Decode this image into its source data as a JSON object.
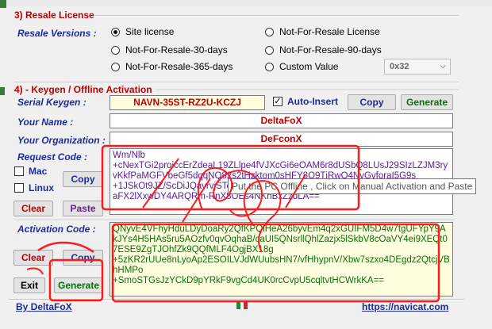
{
  "resale": {
    "title": "3) Resale License",
    "versions_label": "Resale Versions :",
    "options": [
      {
        "label": "Site license",
        "selected": true
      },
      {
        "label": "Not-For-Resale License",
        "selected": false
      },
      {
        "label": "Not-For-Resale-30-days",
        "selected": false
      },
      {
        "label": "Not-For-Resale-90-days",
        "selected": false
      },
      {
        "label": "Not-For-Resale-365-days",
        "selected": false
      },
      {
        "label": "Custom Value",
        "selected": false
      }
    ],
    "custom_value": "0x32"
  },
  "keygen": {
    "title": "4) - Keygen / Offline Activation",
    "serial_label": "Serial Keygen :",
    "serial_value": "NAVN-35ST-RZ2U-KCZJ",
    "auto_insert_label": "Auto-Insert",
    "copy_label": "Copy",
    "generate_label": "Generate",
    "name_label": "Your Name :",
    "name_value": "DeltaFoX",
    "org_label": "Your Organization :",
    "org_value": "DeFconX",
    "request_label": "Request Code :",
    "request_value": "Wm/Nlb\n+cNexTGi2proiccErZdeaL19ZLlpe4fVJXcGi6eOAM6r8dUSbQ8LUsJ29SIzLZJM3ryvKkfPaMGFVbeGf5dqqNQ82s2tHzktom0sHFY8Q9TjRwQ4NvGvforaI5G9s\n+1JSkOt9JZ/ScDiJQavrvjSTenBHFlNhmB636aPLPQ9eE5VAh3tdGeJYXYTQHu12aFX2lXxwDY4ARQRm-RnX8OEs4NKhBxZzdLA==",
    "mac_label": "Mac",
    "linux_label": "Linux",
    "clear_label": "Clear",
    "paste_label": "Paste",
    "activation_label": "Activation Code :",
    "activation_value": "QNyvE4VFhyHduLDyDoaRy2QfKPQiHeA26byvEm4q2xGUIFM5D4w7tgUFYpY9AkJYs4H5HAs5ru5AOzfv0qvOqhaB/caUI5QNsrllQhlZazjx5lSkbV8cOaVY4ei9XEQt07ESE9ZgTJOhfZk9QQfMLF4OgjBX18g\n+5zKR2rUUe8nLyoAp2ESOILVJdWUubsHN7/vfHhypnV/Xbw7szxo4DEgdz2QtcjVBhHMPo\n+SmoSTGsJzYCkD9pYRkF9vgCd4UK0rcCvpU5cqltvtHCWrkKA==",
    "exit_label": "Exit"
  },
  "tooltip": "Put the PC Offline , Click on Manual Activation and Paste",
  "footer": {
    "by": "By DeltaFoX",
    "url": "https://navicat.com"
  }
}
